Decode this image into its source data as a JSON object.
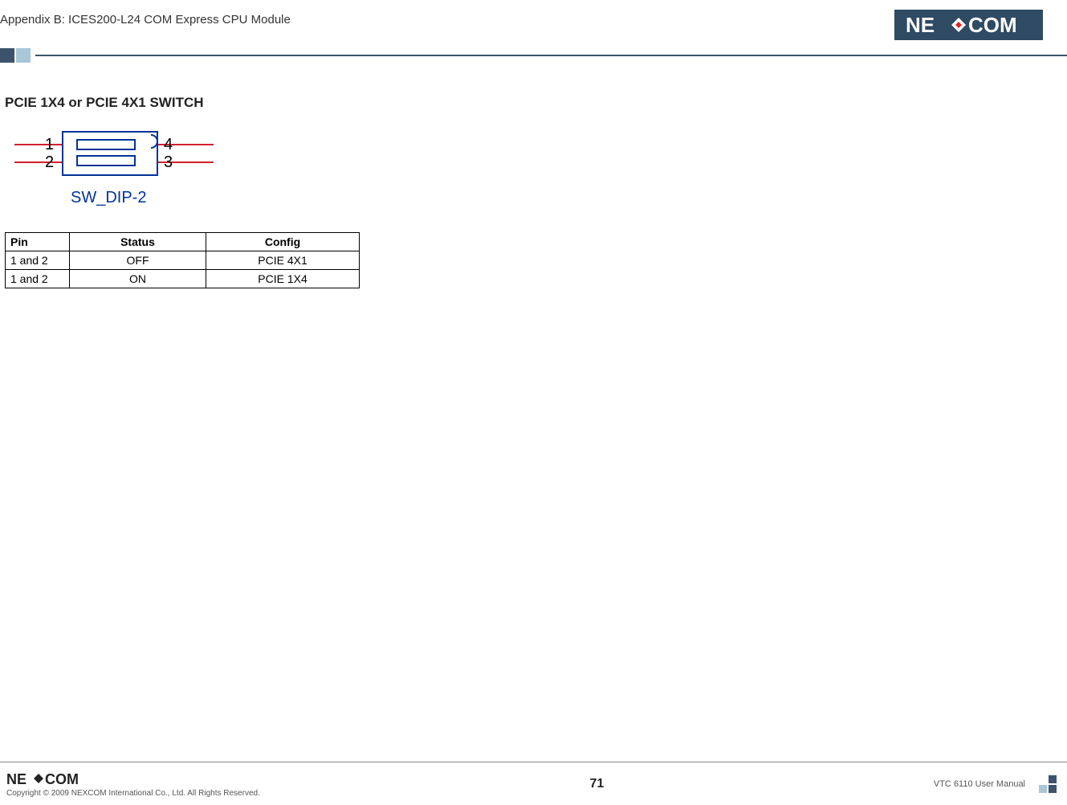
{
  "header": {
    "title": "Appendix B: ICES200-L24 COM Express CPU Module",
    "logo_text_left": "NE",
    "logo_text_right": "COM"
  },
  "section": {
    "title": "PCIE 1X4 or PCIE 4X1 SWITCH"
  },
  "diagram": {
    "pin1": "1",
    "pin2": "2",
    "pin3": "3",
    "pin4": "4",
    "caption": "SW_DIP-2"
  },
  "table": {
    "headers": {
      "pin": "Pin",
      "status": "Status",
      "config": "Config"
    },
    "rows": [
      {
        "pin": "1 and 2",
        "status": "OFF",
        "config": "PCIE 4X1"
      },
      {
        "pin": "1 and 2",
        "status": "ON",
        "config": "PCIE 1X4"
      }
    ]
  },
  "footer": {
    "copyright": "Copyright © 2009 NEXCOM International Co., Ltd. All Rights Reserved.",
    "page": "71",
    "manual": "VTC 6110 User Manual",
    "logo_text_left": "NE",
    "logo_text_right": "COM"
  }
}
